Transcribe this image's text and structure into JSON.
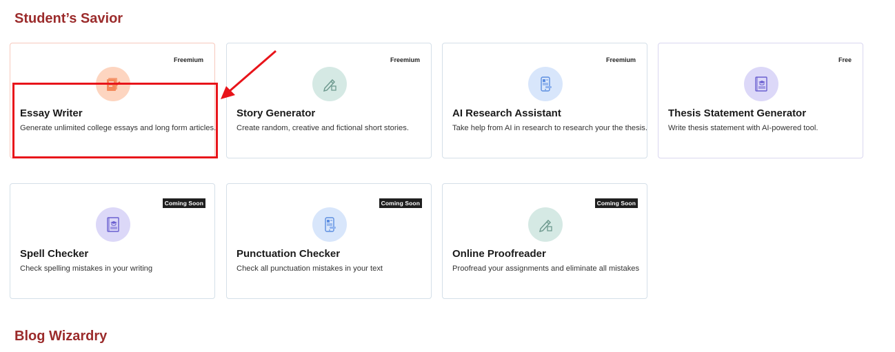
{
  "sections": [
    {
      "title": "Student’s Savior"
    },
    {
      "title": "Blog Wizardry"
    }
  ],
  "cards": [
    {
      "title": "Essay Writer",
      "desc": "Generate unlimited college essays and long form articles.",
      "badge": "Freemium",
      "icon": "essay-document-icon"
    },
    {
      "title": "Story Generator",
      "desc": "Create random, creative and fictional short stories.",
      "badge": "Freemium",
      "icon": "pen-writing-icon"
    },
    {
      "title": "AI Research Assistant",
      "desc": "Take help from AI in research to research your the thesis.",
      "badge": "Freemium",
      "icon": "tablet-document-icon"
    },
    {
      "title": "Thesis Statement Generator",
      "desc": "Write thesis statement with AI-powered tool.",
      "badge": "Free",
      "icon": "graduation-book-icon"
    },
    {
      "title": "Spell Checker",
      "desc": "Check spelling mistakes in your writing",
      "badge": "Coming Soon",
      "icon": "graduation-book-icon"
    },
    {
      "title": "Punctuation Checker",
      "desc": "Check all punctuation mistakes in your text",
      "badge": "Coming Soon",
      "icon": "tablet-document-icon"
    },
    {
      "title": "Online Proofreader",
      "desc": "Proofread your assignments and eliminate all mistakes",
      "badge": "Coming Soon",
      "icon": "pen-writing-icon"
    }
  ],
  "colors": {
    "section_title": "#9b2b2b",
    "highlight": "#e8141a",
    "orange_circle": "#fdd5c0",
    "teal_circle": "#d5e9e4",
    "blue_circle": "#d8e6fb",
    "purple_circle": "#dcd8f8"
  }
}
